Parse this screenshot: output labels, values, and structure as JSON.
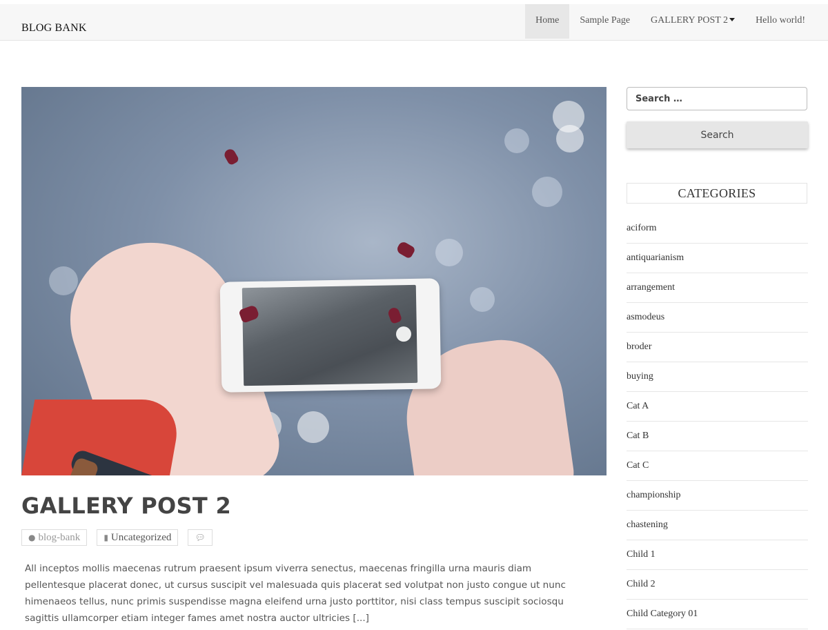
{
  "header": {
    "brand": "BLOG BANK",
    "menu": [
      {
        "label": "Home"
      },
      {
        "label": "Sample Page"
      },
      {
        "label": "GALLERY POST 2"
      },
      {
        "label": "Hello world!"
      }
    ]
  },
  "post": {
    "title": "GALLERY POST 2",
    "author": "blog-bank",
    "category": "Uncategorized",
    "excerpt": "All inceptos mollis maecenas rutrum praesent ipsum viverra senectus, maecenas fringilla urna mauris diam pellentesque placerat donec, ut cursus suscipit vel malesuada quis placerat sed volutpat non justo congue ut nunc himenaeos tellus, nunc primis suspendisse magna eleifend urna justo porttitor, nisi class tempus suscipit sociosqu sagittis ullamcorper etiam integer fames amet nostra auctor ultricies [...]",
    "image_alt": "hands holding a SAMSUNG phone photographing water"
  },
  "sidebar": {
    "search": {
      "placeholder": "Search …",
      "button_label": "Search"
    },
    "categories_title": "CATEGORIES",
    "categories": [
      "aciform",
      "antiquarianism",
      "arrangement",
      "asmodeus",
      "broder",
      "buying",
      "Cat A",
      "Cat B",
      "Cat C",
      "championship",
      "chastening",
      "Child 1",
      "Child 2",
      "Child Category 01"
    ]
  },
  "icons": {
    "author": "user-icon",
    "category": "folder-icon",
    "comments": "comment-icon",
    "dropdown": "caret-down-icon"
  },
  "colors": {
    "navbar_bg": "#f7f7f7",
    "active_menu_bg": "#e7e7e7",
    "search_button_bg": "#e6e6e6",
    "title_color": "#444444"
  }
}
